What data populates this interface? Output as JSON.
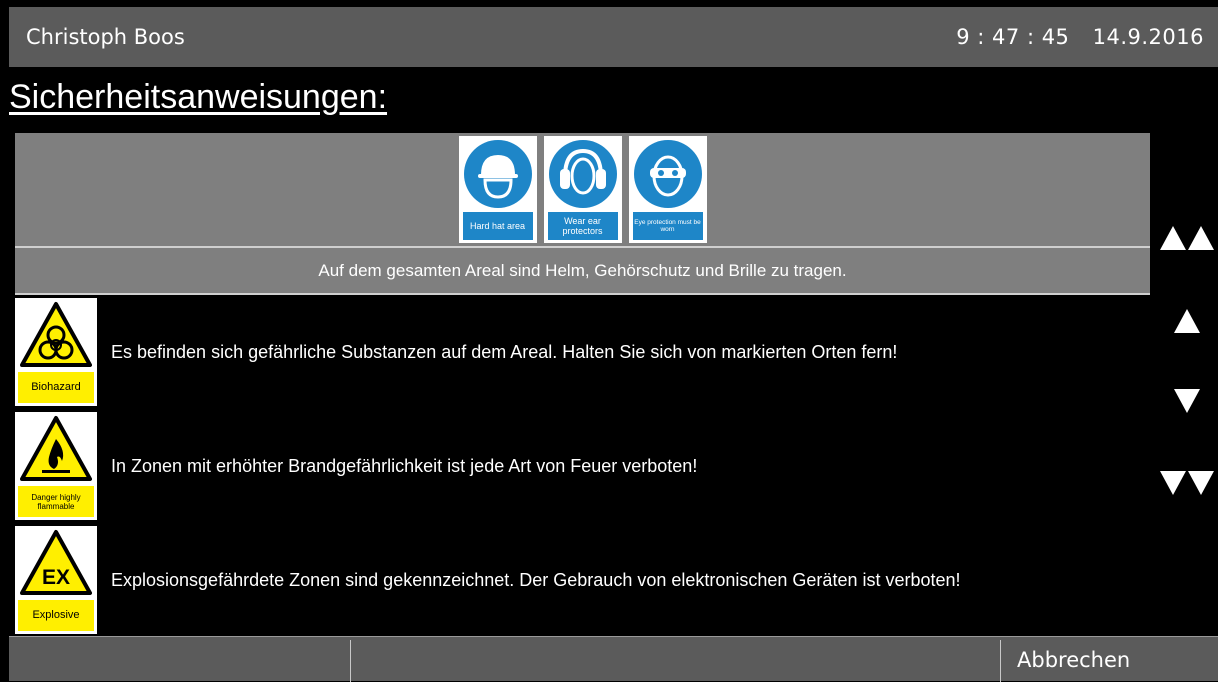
{
  "header": {
    "user_name": "Christoph Boos",
    "time": "9 : 47 : 45",
    "date": "14.9.2016"
  },
  "page_title": "Sicherheitsanweisungen:",
  "ppe": [
    {
      "icon": "hard-hat-icon",
      "caption": "Hard hat area"
    },
    {
      "icon": "ear-protector-icon",
      "caption": "Wear ear protectors"
    },
    {
      "icon": "eye-protection-icon",
      "caption": "Eye protection must be worn"
    }
  ],
  "ppe_note": "Auf dem gesamten Areal sind Helm, Gehörschutz und Brille zu tragen.",
  "instructions": [
    {
      "icon": "biohazard-icon",
      "sign_label": "Biohazard",
      "text": "Es befinden sich gefährliche Substanzen auf dem Areal. Halten Sie sich von markierten Orten fern!"
    },
    {
      "icon": "flammable-icon",
      "sign_label": "Danger highly flammable",
      "text": "In Zonen mit erhöhter Brandgefährlichkeit ist jede Art von Feuer verboten!"
    },
    {
      "icon": "explosive-icon",
      "sign_label": "Explosive",
      "sign_symbol": "EX",
      "text": "Explosionsgefährdete Zonen sind gekennzeichnet. Der Gebrauch von elektronischen Geräten ist verboten!"
    }
  ],
  "navigation": [
    "page-up-icon",
    "line-up-icon",
    "line-down-icon",
    "page-down-icon"
  ],
  "footer": {
    "cancel_label": "Abbrechen"
  },
  "colors": {
    "bar": "#5b5b5b",
    "panel": "#7f7f7f",
    "sign_yellow": "#ffef00",
    "ppe_blue": "#1e86c8"
  }
}
